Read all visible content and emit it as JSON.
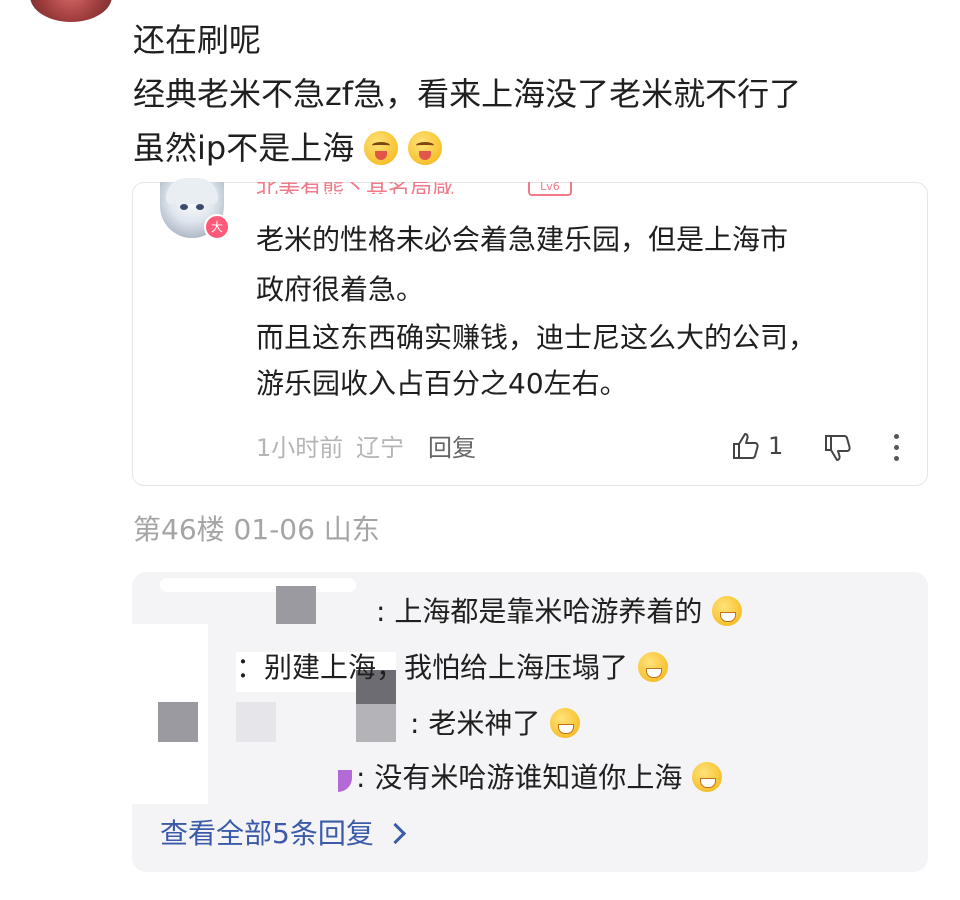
{
  "main_comment": {
    "lines": [
      "还在刷呢",
      "经典老米不急zf急，看来上海没了老米就不行了",
      "虽然ip不是上海"
    ],
    "emoji_names": [
      "yum-face-icon",
      "yum-face-icon"
    ]
  },
  "quoted_reply": {
    "username": "北美有熊丶其名局咸",
    "level": "Lv6",
    "vip_badge": "大",
    "text_lines": [
      "老米的性格未必会着急建乐园，但是上海市",
      "政府很着急。",
      "而且这东西确实赚钱，迪士尼这么大的公司，",
      "游乐园收入占百分之40左右。"
    ],
    "time": "1小时前",
    "location": "辽宁",
    "reply_label": "回复",
    "like_count": "1"
  },
  "floor": {
    "info": "第46楼 01-06 山东"
  },
  "sub_replies": {
    "items": [
      {
        "text": ": 上海都是靠米哈游养着的",
        "emoji": "grin-face-icon"
      },
      {
        "text": "：别建上海，我怕给上海压塌了",
        "emoji": "fearful-face-icon"
      },
      {
        "text": ": 老米神了",
        "emoji": "grin-face-icon"
      },
      {
        "text": ": 没有米哈游谁知道你上海",
        "emoji": "surprised-face-icon"
      }
    ],
    "see_all": "查看全部5条回复"
  }
}
